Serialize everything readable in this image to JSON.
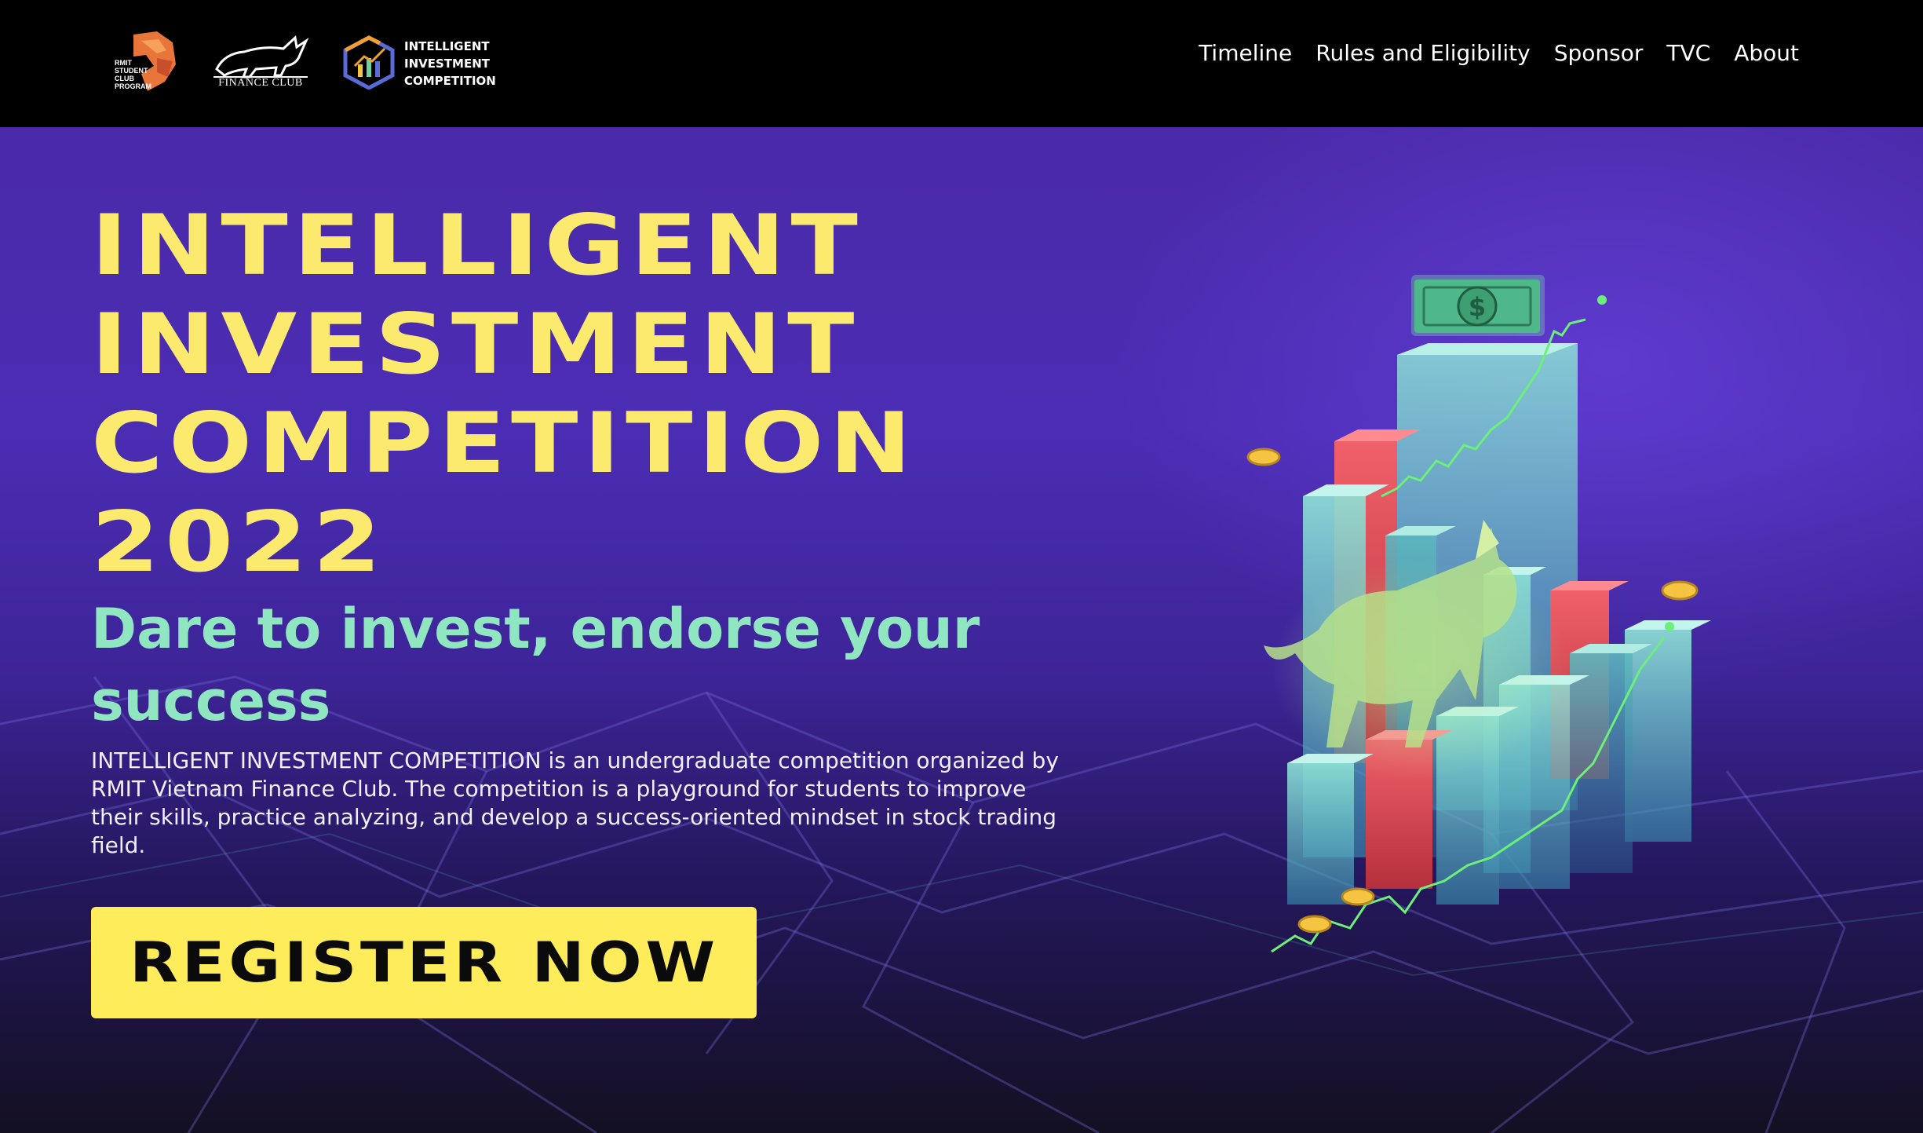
{
  "header": {
    "logos": {
      "rmit_program": [
        "RMIT",
        "STUDENT",
        "CLUB",
        "PROGRAM"
      ],
      "finance_club": "FINANCE CLUB",
      "competition": [
        "INTELLIGENT",
        "INVESTMENT",
        "COMPETITION"
      ]
    },
    "nav": [
      {
        "label": "Timeline"
      },
      {
        "label": "Rules and Eligibility"
      },
      {
        "label": "Sponsor"
      },
      {
        "label": "TVC"
      },
      {
        "label": "About"
      }
    ]
  },
  "hero": {
    "title_lines": [
      "INTELLIGENT",
      "INVESTMENT",
      "COMPETITION",
      "2022"
    ],
    "subtitle": "Dare to invest, endorse your success",
    "description": "INTELLIGENT INVESTMENT COMPETITION is an undergraduate competition organized by RMIT Vietnam Finance Club. The competition is a playground for students to improve their skills, practice analyzing, and develop a success-oriented mindset in stock trading field.",
    "register_label": "REGISTER NOW",
    "illustration": {
      "icons": [
        "dollar-bill-icon",
        "bull-icon",
        "coin-icon",
        "stock-line-icon"
      ],
      "bar_colors": {
        "teal": "#6fd3c8",
        "red": "#e0505a"
      }
    }
  },
  "colors": {
    "title": "#fcea6e",
    "subtitle": "#8fe6c1",
    "button": "#ffec5b",
    "header_bg": "#000000",
    "hero_bg": "#4b2db4"
  }
}
